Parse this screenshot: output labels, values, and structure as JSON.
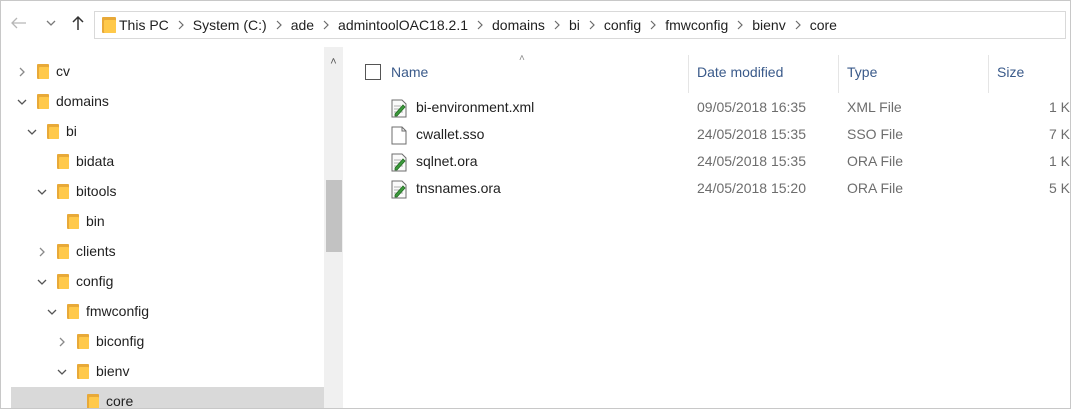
{
  "toolbar": {
    "back_icon": "arrow-left-icon",
    "forward_icon": "chevron-down-icon",
    "up_icon": "arrow-up-icon"
  },
  "breadcrumb": [
    "This PC",
    "System (C:)",
    "ade",
    "admintoolOAC18.2.1",
    "domains",
    "bi",
    "config",
    "fmwconfig",
    "bienv",
    "core"
  ],
  "tree": [
    {
      "label": "cv",
      "expander": ">"
    },
    {
      "label": "domains",
      "expander": "v"
    },
    {
      "label": "bi",
      "expander": "v"
    },
    {
      "label": "bidata",
      "expander": ""
    },
    {
      "label": "bitools",
      "expander": "v"
    },
    {
      "label": "bin",
      "expander": ""
    },
    {
      "label": "clients",
      "expander": ">"
    },
    {
      "label": "config",
      "expander": "v"
    },
    {
      "label": "fmwconfig",
      "expander": "v"
    },
    {
      "label": "biconfig",
      "expander": ">"
    },
    {
      "label": "bienv",
      "expander": "v"
    },
    {
      "label": "core",
      "expander": "",
      "selected": true
    }
  ],
  "columns": {
    "name": "Name",
    "date": "Date modified",
    "type": "Type",
    "size": "Size"
  },
  "files": [
    {
      "name": "bi-environment.xml",
      "date": "09/05/2018 16:35",
      "type": "XML File",
      "size": "1 K",
      "icon": "edit-document-icon"
    },
    {
      "name": "cwallet.sso",
      "date": "24/05/2018 15:35",
      "type": "SSO File",
      "size": "7 K",
      "icon": "blank-document-icon"
    },
    {
      "name": "sqlnet.ora",
      "date": "24/05/2018 15:35",
      "type": "ORA File",
      "size": "1 K",
      "icon": "edit-document-icon"
    },
    {
      "name": "tnsnames.ora",
      "date": "24/05/2018 15:20",
      "type": "ORA File",
      "size": "5 K",
      "icon": "edit-document-icon"
    }
  ],
  "colors": {
    "folder": "#ffc94a",
    "selected_row": "#d9d9d9",
    "header_text": "#3a5a8a"
  }
}
